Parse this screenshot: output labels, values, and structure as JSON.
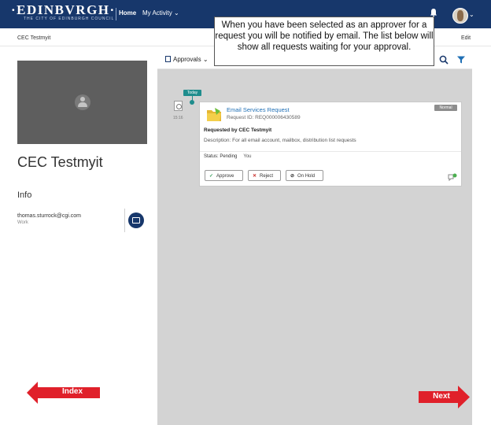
{
  "header": {
    "logo_text": "·EDINBVRGH·",
    "logo_subtitle": "THE CITY OF EDINBURGH COUNCIL",
    "nav_home": "Home",
    "nav_activity": "My Activity",
    "nav_activity_caret": "⌄",
    "avatar_caret": "⌄",
    "brand_color": "#17376b"
  },
  "callout": {
    "text": "When you have been selected as an approver for a request you will be notified by email. The list below will show all requests waiting for your approval."
  },
  "subheader": {
    "name": "CEC Testmyit",
    "edit": "Edit"
  },
  "toolbar": {
    "filter_label": "Approvals",
    "filter_caret": "⌄",
    "search_icon": "search-icon",
    "filter_icon": "funnel-icon"
  },
  "profile": {
    "name": "CEC Testmyit",
    "info_heading": "Info",
    "email": "thomas.sturrock@cgi.com",
    "email_label": "Work",
    "email_icon": "mail-icon"
  },
  "feed": {
    "timeline_label": "Today",
    "time": "15:16",
    "card": {
      "title": "Email Services Request",
      "request_id": "Request ID: REQ000006430589",
      "priority": "Normal",
      "requested_by": "Requested by CEC Testmyit",
      "description": "Description: For all email account, mailbox, distribution list requests",
      "status_label": "Status: Pending",
      "status_you": "You",
      "buttons": {
        "approve": "Approve",
        "approve_mark": "✓",
        "reject": "Reject",
        "reject_mark": "✕",
        "hold": "On Hold",
        "hold_mark": "⊘"
      },
      "approve_color": "#2e9a55",
      "reject_color": "#c9302c"
    }
  },
  "navigation": {
    "prev": "Index",
    "next": "Next",
    "arrow_color": "#e0202a"
  }
}
